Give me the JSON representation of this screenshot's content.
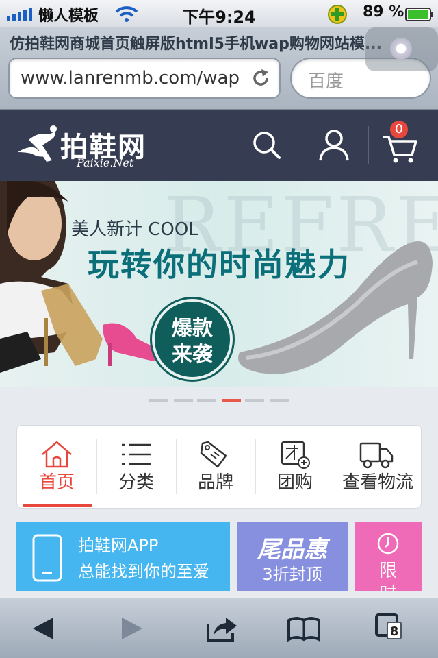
{
  "status_bar": {
    "carrier": "懒人模板",
    "time": "下午9:24",
    "battery": "89 %"
  },
  "browser": {
    "page_title": "仿拍鞋网商城首页触屏版html5手机wap购物网站模...",
    "url": "www.lanrenmb.com/wap",
    "search_placeholder": "百度",
    "tabs_count": "8"
  },
  "site": {
    "logo_text": "拍鞋网",
    "logo_sub": "Paixie.Net",
    "cart_count": "0",
    "accent_color": "#e8473d",
    "header_color": "#363d52"
  },
  "banner": {
    "subtitle": "美人新计 COOL",
    "headline": "玩转你的时尚魅力",
    "badge_line1": "爆款",
    "badge_line2": "来袭",
    "background_text": "REFRESHING",
    "slides": 6,
    "active_slide": 4
  },
  "nav": [
    {
      "label": "首页",
      "icon": "home-icon",
      "active": true
    },
    {
      "label": "分类",
      "icon": "list-icon",
      "active": false
    },
    {
      "label": "品牌",
      "icon": "tag-icon",
      "active": false
    },
    {
      "label": "团购",
      "icon": "group-buy-icon",
      "active": false
    },
    {
      "label": "查看物流",
      "icon": "truck-icon",
      "active": false
    }
  ],
  "promos": {
    "app": {
      "line1": "拍鞋网APP",
      "line2": "总能找到你的至爱",
      "color": "#45b6ef"
    },
    "tail": {
      "line1": "尾品惠",
      "line2": "3折封顶",
      "color": "#8790df"
    },
    "limited": {
      "line1": "限",
      "line2": "时",
      "color": "#f06bb7"
    }
  }
}
